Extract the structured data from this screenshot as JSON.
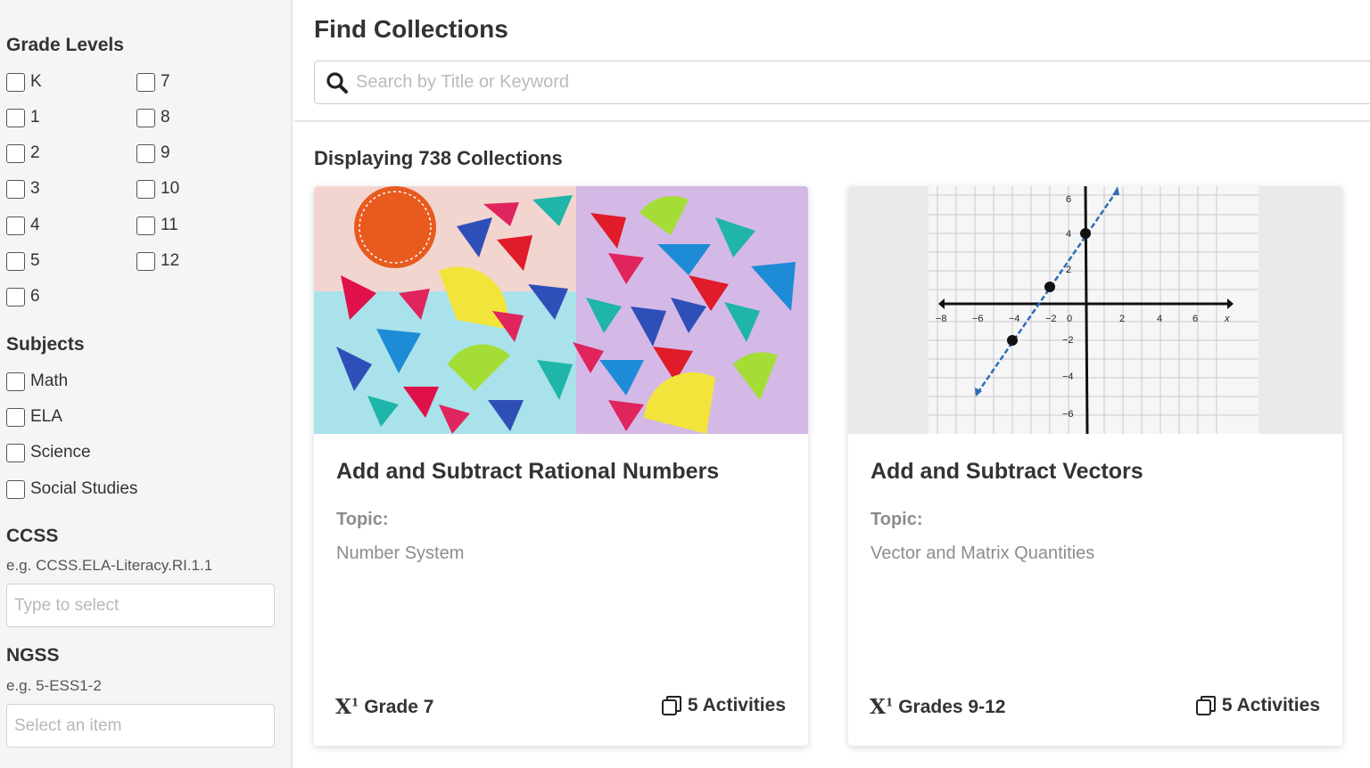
{
  "sidebar": {
    "grade_levels": {
      "title": "Grade Levels",
      "col1": [
        "K",
        "1",
        "2",
        "3",
        "4",
        "5",
        "6"
      ],
      "col2": [
        "7",
        "8",
        "9",
        "10",
        "11",
        "12"
      ]
    },
    "subjects": {
      "title": "Subjects",
      "items": [
        "Math",
        "ELA",
        "Science",
        "Social Studies"
      ]
    },
    "ccss": {
      "title": "CCSS",
      "hint": "e.g. CCSS.ELA-Literacy.RI.1.1",
      "placeholder": "Type to select"
    },
    "ngss": {
      "title": "NGSS",
      "hint": "e.g. 5-ESS1-2",
      "placeholder": "Select an item"
    }
  },
  "header": {
    "title": "Find Collections",
    "search_placeholder": "Search by Title or Keyword"
  },
  "results": {
    "count_text": "Displaying 738 Collections"
  },
  "cards": [
    {
      "title": "Add and Subtract Rational Numbers",
      "topic_label": "Topic:",
      "topic": "Number System",
      "grade": "Grade 7",
      "activities": "5 Activities"
    },
    {
      "title": "Add and Subtract Vectors",
      "topic_label": "Topic:",
      "topic": "Vector and Matrix Quantities",
      "grade": "Grades 9-12",
      "activities": "5 Activities"
    }
  ],
  "graph_labels": {
    "x_ticks": [
      "−8",
      "−6",
      "−4",
      "−2",
      "0",
      "2",
      "4",
      "6",
      "x"
    ],
    "y_ticks": [
      "6",
      "4",
      "2",
      "−2",
      "−4",
      "−6"
    ]
  },
  "colors": {
    "sidebar_bg": "#f4f5f5",
    "card_shadow": "#d0d0d0",
    "muted_text": "#8a8d90"
  }
}
